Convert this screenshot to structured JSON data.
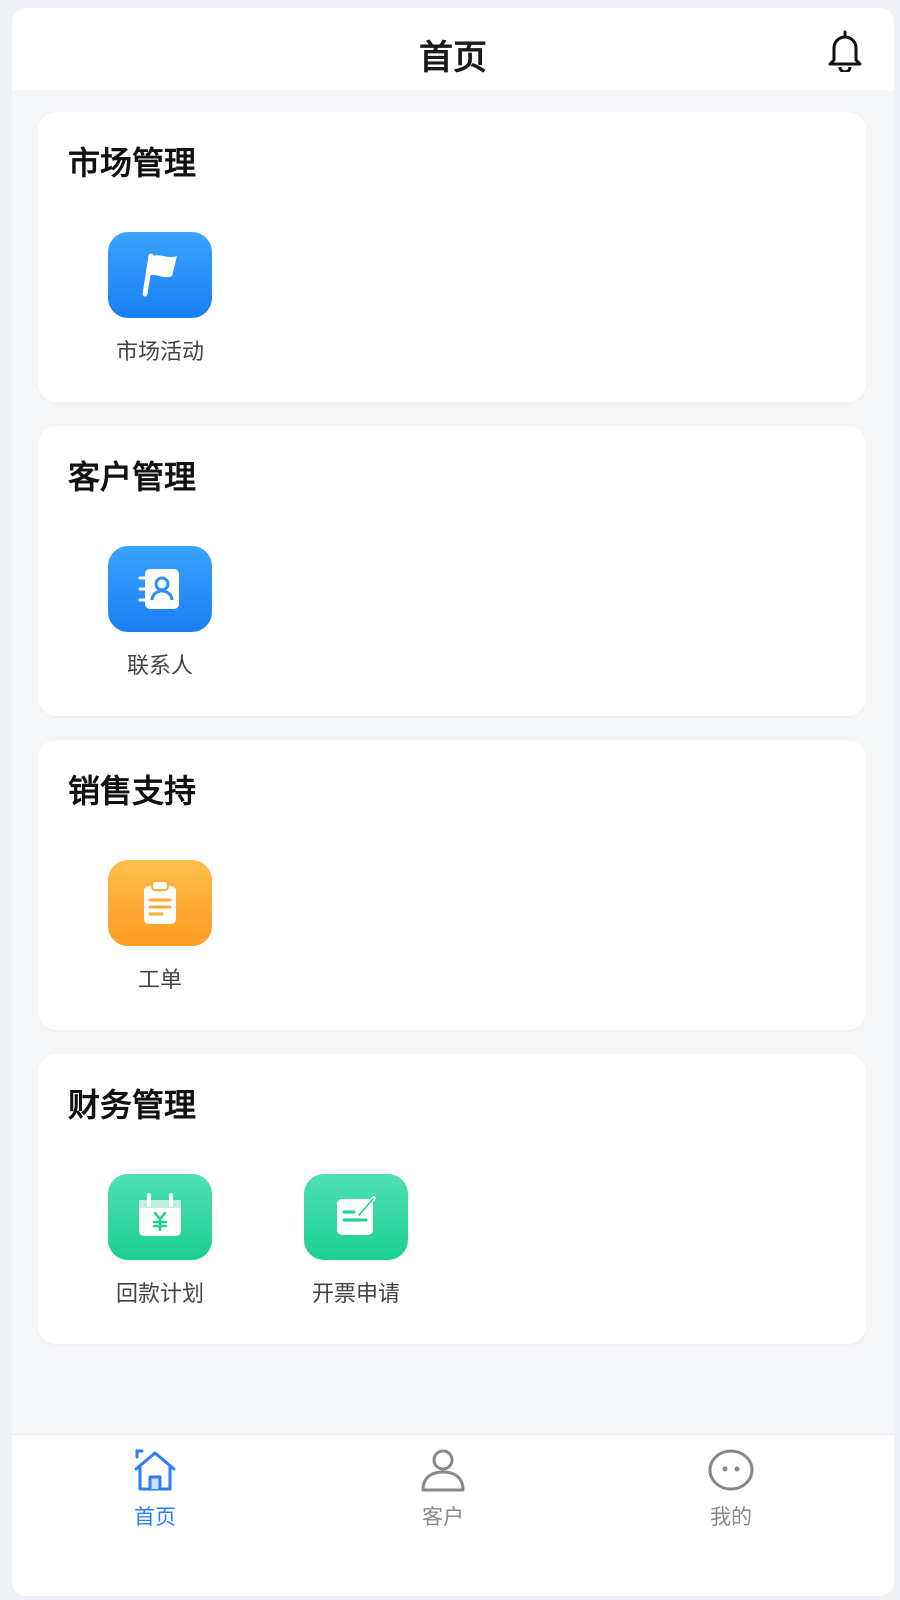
{
  "header": {
    "title": "首页",
    "icon": "bell-icon"
  },
  "sections": [
    {
      "title": "市场管理",
      "items": [
        {
          "label": "市场活动",
          "icon": "flag-icon",
          "color": "#2a8ff8"
        }
      ]
    },
    {
      "title": "客户管理",
      "items": [
        {
          "label": "联系人",
          "icon": "contact-book-icon",
          "color": "#2a8ff8"
        }
      ]
    },
    {
      "title": "销售支持",
      "items": [
        {
          "label": "工单",
          "icon": "clipboard-icon",
          "color": "#ffab2e"
        }
      ]
    },
    {
      "title": "财务管理",
      "items": [
        {
          "label": "回款计划",
          "icon": "calendar-yen-icon",
          "color": "#2bd5a0"
        },
        {
          "label": "开票申请",
          "icon": "invoice-edit-icon",
          "color": "#2bd5a0"
        }
      ]
    }
  ],
  "tabbar": {
    "items": [
      {
        "label": "首页",
        "icon": "home-icon",
        "active": true
      },
      {
        "label": "客户",
        "icon": "user-icon",
        "active": false
      },
      {
        "label": "我的",
        "icon": "face-icon",
        "active": false
      }
    ],
    "active_color": "#2f7df6",
    "inactive_color": "#888888"
  }
}
